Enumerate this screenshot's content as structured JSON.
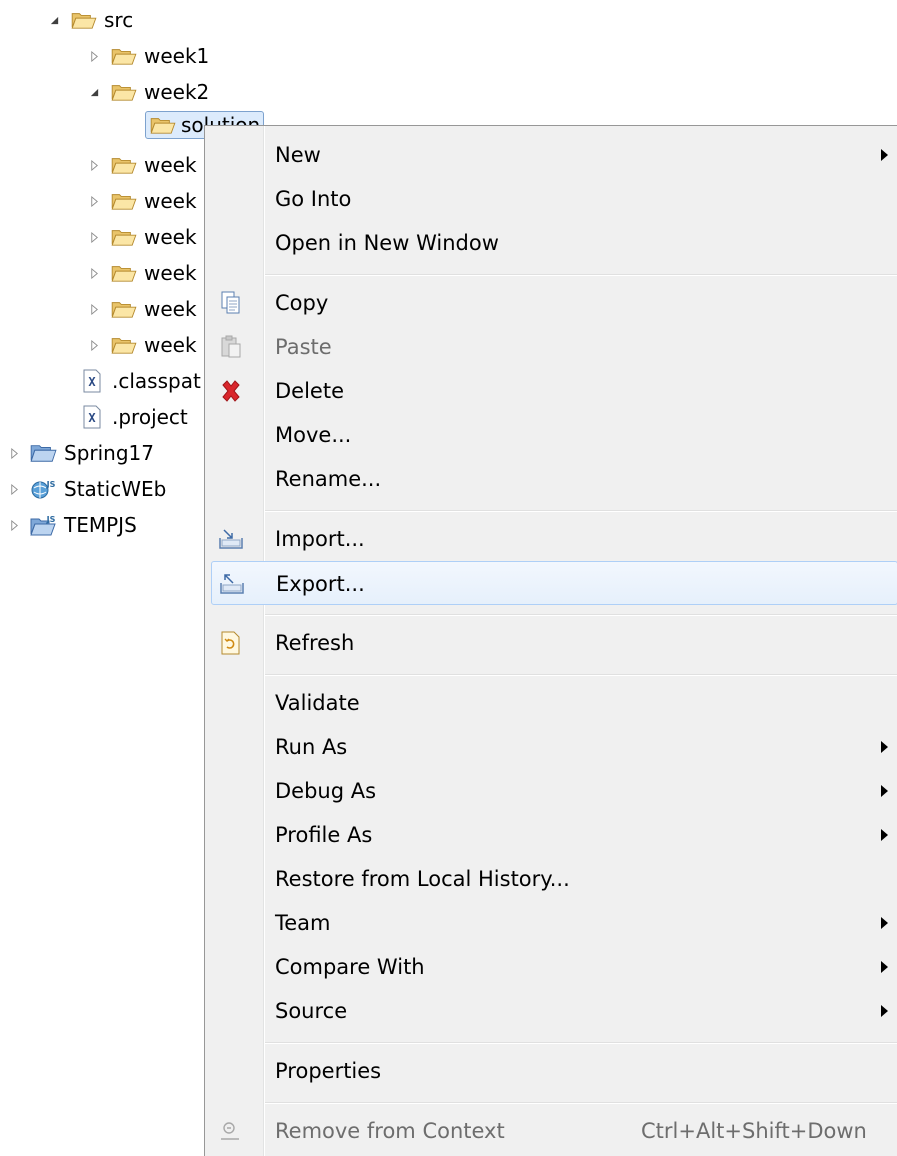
{
  "tree": {
    "items": [
      {
        "label": "src"
      },
      {
        "label": "week1"
      },
      {
        "label": "week2"
      },
      {
        "label": "solution"
      },
      {
        "label": "week"
      },
      {
        "label": "week"
      },
      {
        "label": "week"
      },
      {
        "label": "week"
      },
      {
        "label": "week"
      },
      {
        "label": "week"
      },
      {
        "label": ".classpat"
      },
      {
        "label": ".project"
      },
      {
        "label": "Spring17"
      },
      {
        "label": "StaticWEb"
      },
      {
        "label": "TEMPJS"
      }
    ]
  },
  "menu": {
    "items": [
      {
        "label": "New"
      },
      {
        "label": "Go Into"
      },
      {
        "label": "Open in New Window"
      },
      {
        "label": "Copy"
      },
      {
        "label": "Paste"
      },
      {
        "label": "Delete"
      },
      {
        "label": "Move..."
      },
      {
        "label": "Rename..."
      },
      {
        "label": "Import..."
      },
      {
        "label": "Export..."
      },
      {
        "label": "Refresh"
      },
      {
        "label": "Validate"
      },
      {
        "label": "Run As"
      },
      {
        "label": "Debug As"
      },
      {
        "label": "Profile As"
      },
      {
        "label": "Restore from Local History..."
      },
      {
        "label": "Team"
      },
      {
        "label": "Compare With"
      },
      {
        "label": "Source"
      },
      {
        "label": "Properties"
      },
      {
        "label": "Remove from Context",
        "shortcut": "Ctrl+Alt+Shift+Down"
      }
    ]
  },
  "colors": {
    "menu_background": "#f0f0f0",
    "hover_border": "#aecff7",
    "folder_fill": "#f5d892",
    "delete_red": "#d9262c"
  }
}
